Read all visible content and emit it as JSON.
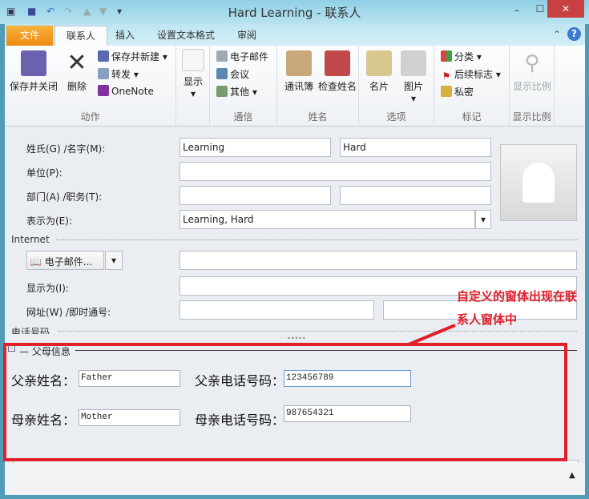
{
  "window": {
    "title": "Hard Learning - 联系人",
    "min": "–",
    "max": "☐",
    "close": "✕"
  },
  "quick_access": {
    "icons": [
      "contact-card-icon",
      "save-icon",
      "undo-icon",
      "redo-icon",
      "up-icon",
      "down-icon",
      "customize-icon"
    ]
  },
  "tabs": [
    {
      "label": "文件"
    },
    {
      "label": "联系人"
    },
    {
      "label": "插入"
    },
    {
      "label": "设置文本格式"
    },
    {
      "label": "审阅"
    }
  ],
  "ribbon": {
    "groups": [
      {
        "label": "动作",
        "items": [
          "保存并关闭",
          "删除",
          "保存并新建",
          "转发",
          "OneNote"
        ]
      },
      {
        "label": "",
        "items": [
          "显示"
        ]
      },
      {
        "label": "通信",
        "items": [
          "电子邮件",
          "会议",
          "其他"
        ]
      },
      {
        "label": "姓名",
        "items": [
          "通讯簿",
          "检查姓名"
        ]
      },
      {
        "label": "选项",
        "items": [
          "名片",
          "图片"
        ]
      },
      {
        "label": "标记",
        "items": [
          "分类",
          "后续标志",
          "私密"
        ]
      },
      {
        "label": "显示比例",
        "items": [
          "显示比例"
        ]
      }
    ]
  },
  "form": {
    "name_label": "姓氏(G)  /名字(M):",
    "last_name": "Learning",
    "first_name": "Hard",
    "company_label": "单位(P):",
    "company": "",
    "dept_label": "部门(A)  /职务(T):",
    "dept": "",
    "job": "",
    "fileas_label": "表示为(E):",
    "fileas": "Learning, Hard",
    "internet_section": "Internet",
    "email_button": "电子邮件...",
    "email": "",
    "display_label": "显示为(I):",
    "display": "",
    "web_label": "网址(W)  /即时通号:",
    "web": "",
    "im": "",
    "phone_section": "电话号码"
  },
  "custom_region": {
    "title": "父母信息",
    "father_name_label": "父亲姓名：",
    "father_name": "Father",
    "father_phone_label": "父亲电话号码：",
    "father_phone": "123456789",
    "mother_name_label": "母亲姓名：",
    "mother_name": "Mother",
    "mother_phone_label": "母亲电话号码：",
    "mother_phone": "987654321"
  },
  "annotation": {
    "line1": "自定义的窗体出现在联",
    "line2": "系人窗体中",
    "color": "#e0202c"
  }
}
